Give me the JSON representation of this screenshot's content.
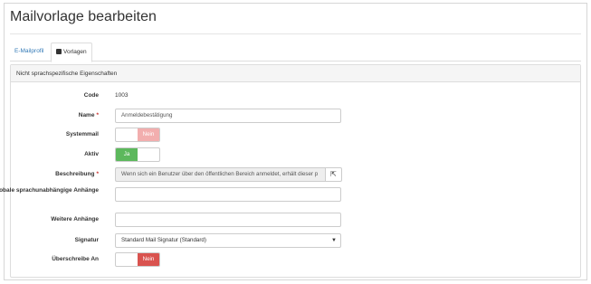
{
  "page": {
    "title": "Mailvorlage bearbeiten"
  },
  "tabs": [
    {
      "label": "E-Mailprofil"
    },
    {
      "label": "Vorlagen"
    }
  ],
  "panel": {
    "heading": "Nicht sprachspezifische Eigenschaften"
  },
  "form": {
    "code": {
      "label": "Code",
      "value": "1003"
    },
    "name": {
      "label": "Name",
      "value": "Anmeldebestätigung",
      "required_mark": "*"
    },
    "systemmail": {
      "label": "Systemmail",
      "toggle_text": "Nein",
      "state": "off"
    },
    "aktiv": {
      "label": "Aktiv",
      "toggle_text": "Ja",
      "state": "on"
    },
    "beschreibung": {
      "label": "Beschreibung",
      "required_mark": "*",
      "value": "Wenn sich ein Benutzer über den öffentlichen Bereich anmeldet, erhält dieser p",
      "button_icon": "external-link-icon"
    },
    "globale_anhaenge": {
      "label": "Globale sprachunabhängige Anhänge",
      "value": ""
    },
    "weitere_anhaenge": {
      "label": "Weitere Anhänge",
      "value": ""
    },
    "signatur": {
      "label": "Signatur",
      "selected": "Standard Mail Signatur (Standard)"
    },
    "ueberschreibe_an": {
      "label": "Überschreibe An",
      "toggle_text": "Nein",
      "state": "off"
    }
  },
  "colors": {
    "link": "#337ab7",
    "toggle_on": "#5cb85c",
    "toggle_off_light": "#f2aeae",
    "toggle_off": "#d9534f"
  }
}
